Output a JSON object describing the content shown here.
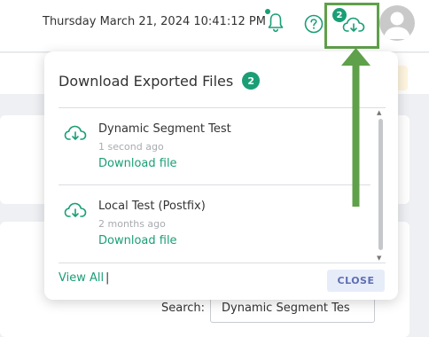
{
  "header": {
    "datetime": "Thursday March 21, 2024 10:41:12 PM",
    "icons": {
      "notifications": "bell-icon",
      "help": "help-circle-icon",
      "downloads": "cloud-download-icon",
      "profile": "user-avatar"
    },
    "download_count": "2"
  },
  "popup": {
    "title": "Download Exported Files",
    "count": "2",
    "items": [
      {
        "name": "Dynamic Segment Test",
        "time": "1 second ago",
        "link": "Download file"
      },
      {
        "name": "Local Test (Postfix)",
        "time": "2 months ago",
        "link": "Download file"
      }
    ],
    "view_all": "View All",
    "close": "CLOSE"
  },
  "page": {
    "search_label": "Search:",
    "search_value": "Dynamic Segment Tes"
  },
  "colors": {
    "accent": "#1a9e76",
    "highlight": "#5fa04a",
    "close_text": "#5d6fb3"
  }
}
